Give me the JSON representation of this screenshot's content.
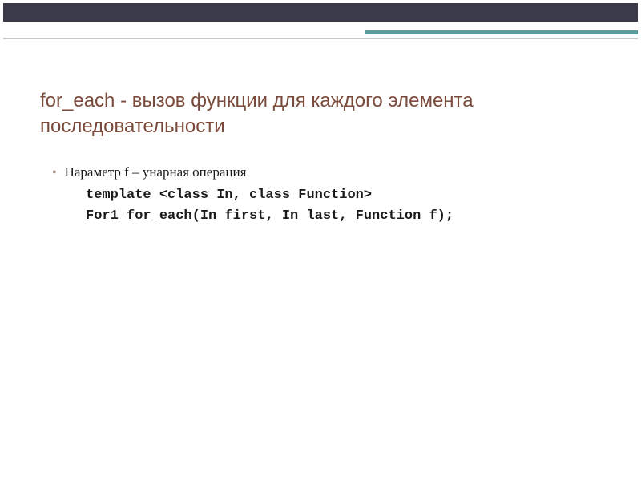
{
  "title": "for_each - вызов функции для каждого элемента последовательности",
  "bullet": {
    "marker": "•",
    "text": "Параметр f – унарная операция"
  },
  "code": {
    "line1": "template <class In, class Function>",
    "line2": "For1 for_each(In first, In last, Function f);"
  }
}
